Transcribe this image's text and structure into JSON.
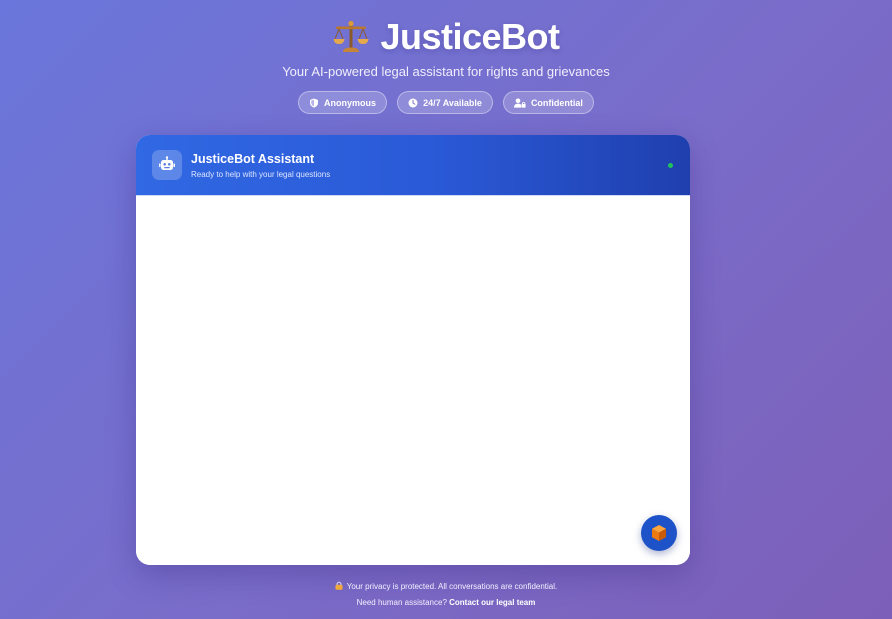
{
  "app": {
    "title": "JusticeBot",
    "subtitle": "Your AI-powered legal assistant for rights and grievances",
    "logo_icon": "balance-scale-icon"
  },
  "badges": [
    {
      "label": "Anonymous",
      "icon": "shield-icon"
    },
    {
      "label": "24/7 Available",
      "icon": "clock-icon"
    },
    {
      "label": "Confidential",
      "icon": "user-lock-icon"
    }
  ],
  "chat": {
    "title": "JusticeBot Assistant",
    "subtitle": "Ready to help with your legal questions",
    "avatar_icon": "robot-icon",
    "status": "online",
    "fab_icon": "cube-icon"
  },
  "footer": {
    "privacy_text": "Your privacy is protected. All conversations are confidential.",
    "help_prefix": "Need human assistance?",
    "help_link": "Contact our legal team",
    "privacy_icon": "lock-icon"
  },
  "colors": {
    "background_start": "#6a76db",
    "background_end": "#7c5fb8",
    "header_start": "#3168e3",
    "header_end": "#1f3fae",
    "status_online": "#21c25e",
    "fab": "#1d52c8",
    "fab_cube": "#f07a12"
  }
}
